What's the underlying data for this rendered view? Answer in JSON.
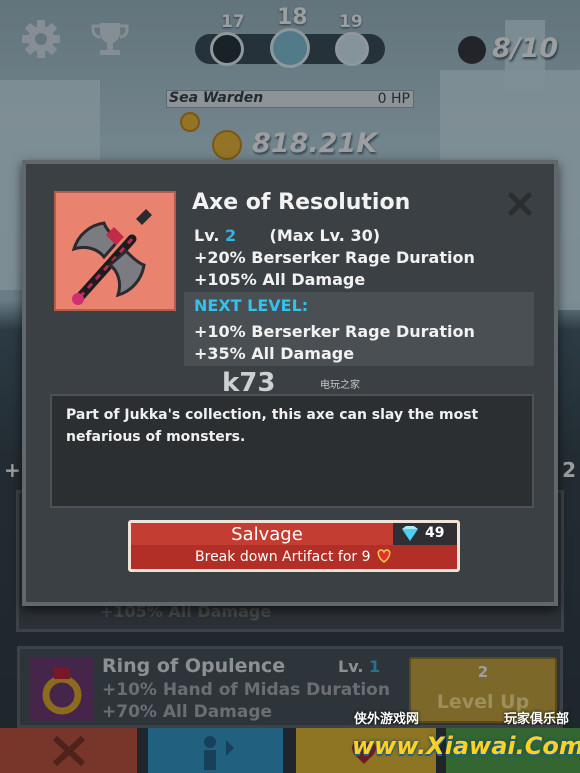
{
  "hud": {
    "stages": [
      "17",
      "18",
      "19"
    ],
    "monsters_count": "8/10",
    "boss_name": "Sea Warden",
    "boss_hp": "0 HP",
    "gold": "818.21K"
  },
  "background_list": {
    "plus_left": "+",
    "plus_right": "2",
    "hidden_item_text": "+105% All Damage",
    "ring": {
      "name": "Ring of Opulence",
      "level_prefix": "Lv.",
      "level": "1",
      "stat1": "+10% Hand of Midas Duration",
      "stat2": "+70% All Damage",
      "upgrade_cost": "2",
      "upgrade_label": "Level Up"
    }
  },
  "modal": {
    "title": "Axe of Resolution",
    "level_prefix": "Lv.",
    "level": "2",
    "max_level": "(Max Lv. 30)",
    "stats": [
      "+20% Berserker Rage Duration",
      "+105% All Damage"
    ],
    "next_level_heading": "NEXT LEVEL:",
    "next_stats": [
      "+10% Berserker Rage Duration",
      "+35% All Damage"
    ],
    "description": "Part of Jukka's collection, this axe can slay the most nefarious of monsters.",
    "salvage": {
      "label": "Salvage",
      "gem_cost": "49",
      "subtext": "Break down Artifact for 9"
    }
  },
  "watermarks": {
    "k73": "k73",
    "k73_sub": "电玩之家",
    "xiawai_top_left": "侠外游戏网",
    "xiawai_top_right": "玩家俱乐部",
    "xiawai_main": "www.Xiawai.Com"
  },
  "colors": {
    "accent_blue": "#2fb5e6",
    "salvage_red": "#b12f26",
    "levelup_gold": "#c9a233",
    "panel_dark": "#3b4044"
  },
  "icons": [
    "gear-icon",
    "trophy-icon",
    "demon-icon",
    "coin-icon",
    "close-icon",
    "axe-icon",
    "diamond-icon",
    "artifact-icon",
    "ring-icon",
    "sword-tab-icon",
    "hero-tab-icon",
    "artifact-tab-icon"
  ]
}
